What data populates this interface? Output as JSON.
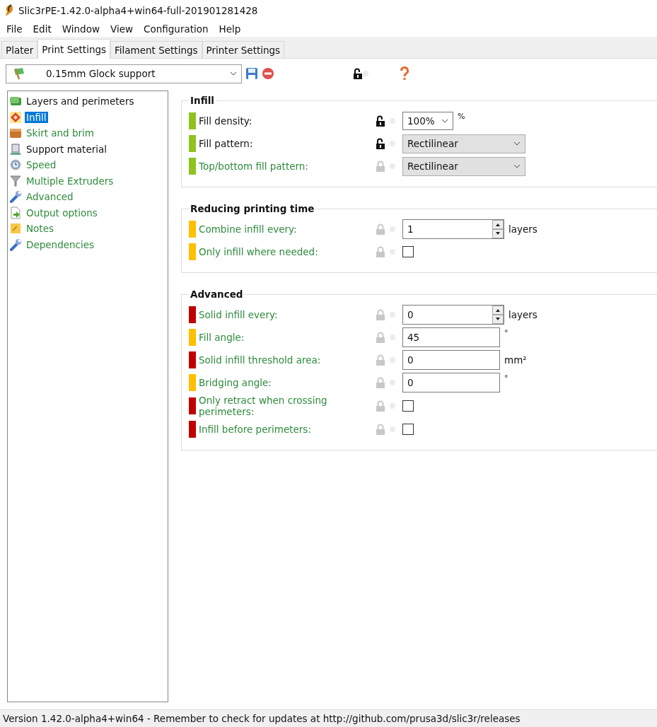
{
  "window": {
    "title": "Slic3rPE-1.42.0-alpha4+win64-full-201901281428"
  },
  "menu": [
    "File",
    "Edit",
    "Window",
    "View",
    "Configuration",
    "Help"
  ],
  "tabs": [
    {
      "label": "Plater",
      "selected": false
    },
    {
      "label": "Print Settings",
      "selected": true
    },
    {
      "label": "Filament Settings",
      "selected": false
    },
    {
      "label": "Printer Settings",
      "selected": false
    }
  ],
  "preset": {
    "value": "0.15mm Glock support",
    "modified": true
  },
  "sidebar": {
    "items": [
      {
        "label": "Layers and perimeters",
        "modified": true,
        "selected": false
      },
      {
        "label": "Infill",
        "modified": true,
        "selected": true
      },
      {
        "label": "Skirt and brim",
        "modified": false,
        "selected": false
      },
      {
        "label": "Support material",
        "modified": true,
        "selected": false
      },
      {
        "label": "Speed",
        "modified": false,
        "selected": false
      },
      {
        "label": "Multiple Extruders",
        "modified": false,
        "selected": false
      },
      {
        "label": "Advanced",
        "modified": false,
        "selected": false
      },
      {
        "label": "Output options",
        "modified": false,
        "selected": false
      },
      {
        "label": "Notes",
        "modified": false,
        "selected": false
      },
      {
        "label": "Dependencies",
        "modified": false,
        "selected": false
      }
    ]
  },
  "groups": [
    {
      "title": "Infill",
      "options": [
        {
          "label": "Fill density:",
          "kind": "combo",
          "value": "100%",
          "unit": "%",
          "color": "#8fc31f",
          "modified": true
        },
        {
          "label": "Fill pattern:",
          "kind": "choice",
          "value": "Rectilinear",
          "color": "#8fc31f",
          "modified": true
        },
        {
          "label": "Top/bottom fill pattern:",
          "kind": "choice",
          "value": "Rectilinear",
          "color": "#8fc31f",
          "modified": false
        }
      ]
    },
    {
      "title": "Reducing printing time",
      "options": [
        {
          "label": "Combine infill every:",
          "kind": "spin",
          "value": "1",
          "unit": "layers",
          "color": "#ffc000",
          "modified": false
        },
        {
          "label": "Only infill where needed:",
          "kind": "checkbox",
          "checked": false,
          "color": "#ffc000",
          "modified": false
        }
      ]
    },
    {
      "title": "Advanced",
      "options": [
        {
          "label": "Solid infill every:",
          "kind": "spin",
          "value": "0",
          "unit": "layers",
          "color": "#c00000",
          "modified": false
        },
        {
          "label": "Fill angle:",
          "kind": "text",
          "value": "45",
          "unit": "°",
          "color": "#ffc000",
          "modified": false
        },
        {
          "label": "Solid infill threshold area:",
          "kind": "text",
          "value": "0",
          "unit": "mm²",
          "color": "#c00000",
          "modified": false
        },
        {
          "label": "Bridging angle:",
          "kind": "text",
          "value": "0",
          "unit": "°",
          "color": "#ffc000",
          "modified": false
        },
        {
          "label": "Only retract when crossing perimeters:",
          "kind": "checkbox",
          "checked": false,
          "color": "#c00000",
          "modified": false
        },
        {
          "label": "Infill before perimeters:",
          "kind": "checkbox",
          "checked": false,
          "color": "#c00000",
          "modified": false
        }
      ]
    }
  ],
  "status_bar": "Version 1.42.0-alpha4+win64 - Remember to check for updates at http://github.com/prusa3d/slic3r/releases"
}
